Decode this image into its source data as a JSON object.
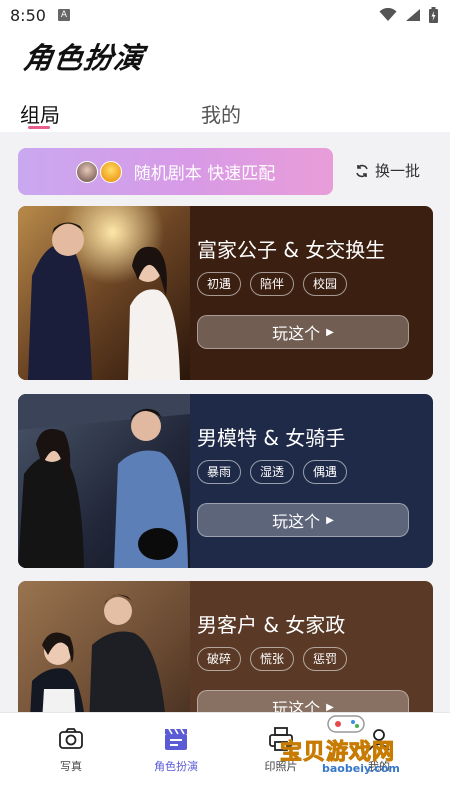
{
  "status_bar": {
    "time": "8:50",
    "notif_icon": "A"
  },
  "header": {
    "app_title": "角色扮演",
    "tabs": [
      {
        "label": "组局",
        "active": true
      },
      {
        "label": "我的",
        "active": false
      }
    ]
  },
  "match": {
    "label": "随机剧本 快速匹配",
    "refresh_label": "换一批"
  },
  "cards": [
    {
      "title": "富家公子 & 女交换生",
      "tags": [
        "初遇",
        "陪伴",
        "校园"
      ],
      "button": "玩这个",
      "bg": "#3b1f10"
    },
    {
      "title": "男模特 & 女骑手",
      "tags": [
        "暴雨",
        "湿透",
        "偶遇"
      ],
      "button": "玩这个",
      "bg": "#1f2a48"
    },
    {
      "title": "男客户 & 女家政",
      "tags": [
        "破碎",
        "慌张",
        "惩罚"
      ],
      "button": "玩这个",
      "bg": "#5a3a26"
    }
  ],
  "bottom_nav": [
    {
      "label": "写真",
      "icon": "camera-icon"
    },
    {
      "label": "角色扮演",
      "icon": "clapperboard-icon",
      "active": true
    },
    {
      "label": "印照片",
      "icon": "printer-icon"
    },
    {
      "label": "我的",
      "icon": "profile-icon"
    }
  ],
  "watermark": {
    "text": "宝贝游戏网",
    "url": "baobeiy.com"
  },
  "colors": {
    "accent_pink": "#e85d8c",
    "active_nav": "#5b5bd6"
  }
}
